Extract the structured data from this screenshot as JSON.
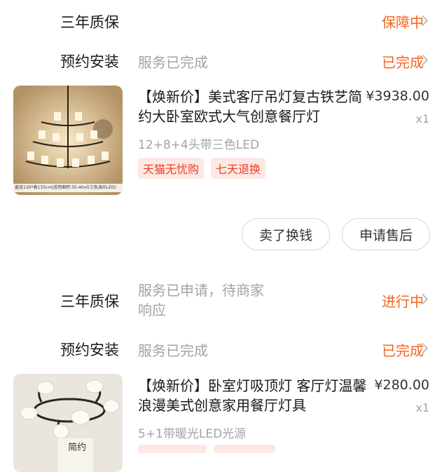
{
  "order1": {
    "warranty": {
      "label": "三年质保",
      "status": "保障中"
    },
    "install": {
      "label": "预约安装",
      "service": "服务已完成",
      "status": "已完成"
    },
    "product": {
      "title": "【焕新价】美式客厅吊灯复古铁艺简约大卧室欧式大气创意餐厅灯",
      "price": "¥3938.00",
      "qty": "x1",
      "spec": "12+8+4头带三色LED",
      "tags": [
        "天猫无忧购",
        "七天退换"
      ],
      "image_caption": "直径130*高135cm|适用面积:35-40㎡(三色调光LED)"
    },
    "actions": {
      "sell": "卖了换钱",
      "aftersale": "申请售后"
    }
  },
  "order2": {
    "warranty": {
      "label": "三年质保",
      "service_line1": "服务已申请，待商家",
      "service_line2": "响应",
      "status": "进行中"
    },
    "install": {
      "label": "预约安装",
      "service": "服务已完成",
      "status": "已完成"
    },
    "product": {
      "title": "【焕新价】卧室灯吸顶灯 客厅灯温馨浪漫美式创意家用餐厅灯具",
      "price": "¥280.00",
      "qty": "x1",
      "spec": "5+1带暖光LED光源",
      "image_caption": "简约"
    }
  }
}
